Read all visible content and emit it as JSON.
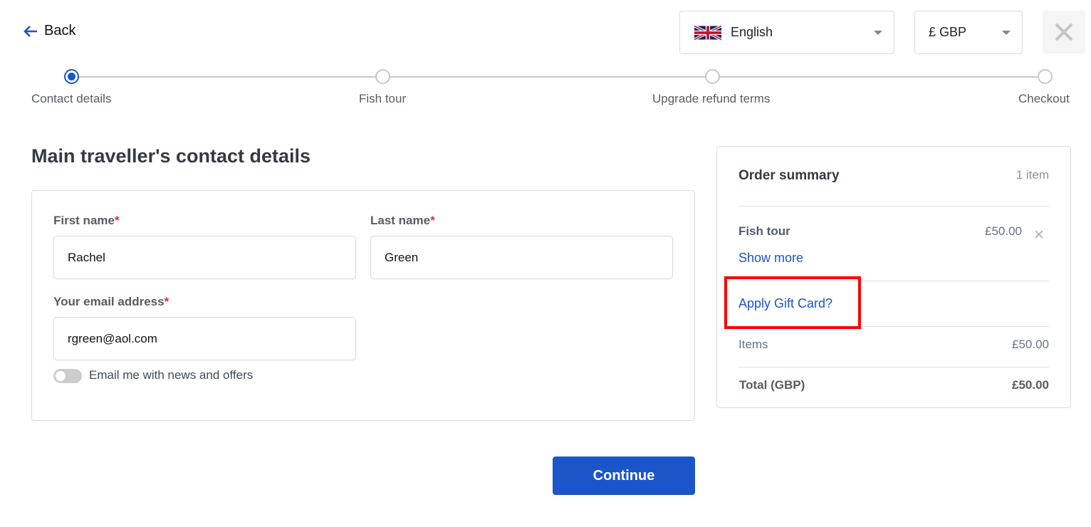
{
  "header": {
    "back_label": "Back",
    "language": {
      "selected": "English",
      "flag": "uk-flag-icon"
    },
    "currency": {
      "selected": "£ GBP"
    },
    "close_icon": "close-icon"
  },
  "steps": [
    {
      "label": "Contact details",
      "active": true
    },
    {
      "label": "Fish tour",
      "active": false
    },
    {
      "label": "Upgrade refund terms",
      "active": false
    },
    {
      "label": "Checkout",
      "active": false
    }
  ],
  "form": {
    "title": "Main traveller's contact details",
    "required_mark": "*",
    "first_name": {
      "label": "First name",
      "value": "Rachel"
    },
    "last_name": {
      "label": "Last name",
      "value": "Green"
    },
    "email": {
      "label": "Your email address",
      "value": "rgreen@aol.com"
    },
    "newsletter": {
      "label": "Email me with news and offers",
      "checked": false
    },
    "continue_label": "Continue"
  },
  "summary": {
    "title": "Order summary",
    "count": "1 item",
    "item": {
      "name": "Fish tour",
      "price": "£50.00",
      "show_more": "Show more"
    },
    "gift_card": "Apply Gift Card?",
    "items_label": "Items",
    "items_value": "£50.00",
    "total_label": "Total (GBP)",
    "total_value": "£50.00"
  },
  "colors": {
    "accent": "#1a56c9",
    "required": "#e03030",
    "highlight": "#ff0000"
  }
}
